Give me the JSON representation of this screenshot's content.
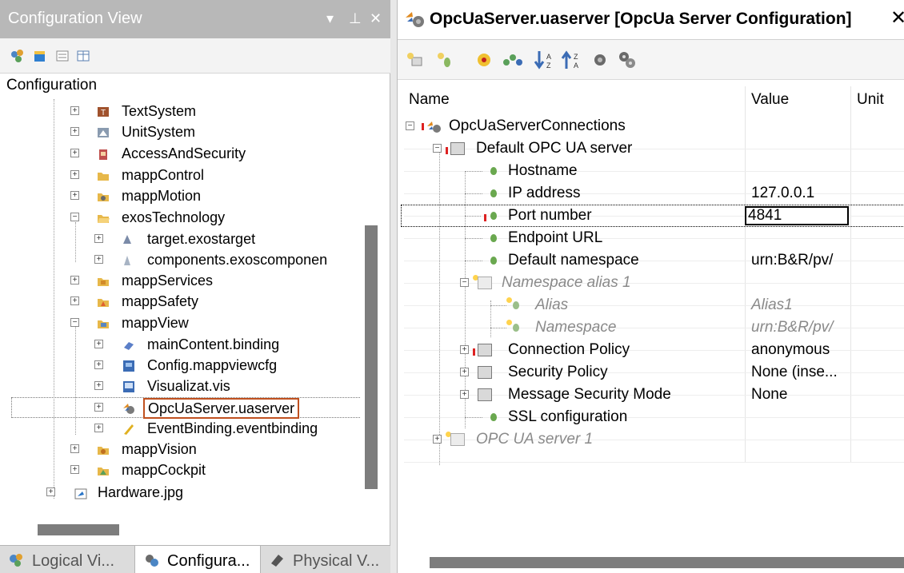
{
  "colors": {
    "title_bar_bg": "#b8b8b8",
    "selection_border": "#c0501f",
    "leaf_green": "#6aa84f",
    "error_red": "#dd2222",
    "folder_yellow": "#e7b84a"
  },
  "left_panel": {
    "title": "Configuration View",
    "controls": {
      "dropdown": "▾",
      "pin": "⊥",
      "close": "✕"
    },
    "toolbar_icons": [
      "logical-icon",
      "cube-icon",
      "list-icon",
      "table-icon"
    ],
    "tree": {
      "root": "Configuration",
      "items": [
        {
          "label": "TextSystem",
          "icon": "text-system-icon"
        },
        {
          "label": "UnitSystem",
          "icon": "unit-system-icon"
        },
        {
          "label": "AccessAndSecurity",
          "icon": "security-icon"
        },
        {
          "label": "mappControl",
          "icon": "folder-icon"
        },
        {
          "label": "mappMotion",
          "icon": "folder-icon"
        },
        {
          "label": "exosTechnology",
          "icon": "folder-open-icon"
        },
        {
          "label": "target.exostarget",
          "icon": "target-icon"
        },
        {
          "label": "components.exoscomponen",
          "icon": "components-icon"
        },
        {
          "label": "mappServices",
          "icon": "folder-icon"
        },
        {
          "label": "mappSafety",
          "icon": "folder-icon"
        },
        {
          "label": "mappView",
          "icon": "folder-open-icon"
        },
        {
          "label": "mainContent.binding",
          "icon": "binding-icon"
        },
        {
          "label": "Config.mappviewcfg",
          "icon": "config-icon"
        },
        {
          "label": "Visualizat.vis",
          "icon": "vis-icon"
        },
        {
          "label": "OpcUaServer.uaserver",
          "icon": "uaserver-icon"
        },
        {
          "label": "EventBinding.eventbinding",
          "icon": "eventbinding-icon"
        },
        {
          "label": "mappVision",
          "icon": "folder-icon"
        },
        {
          "label": "mappCockpit",
          "icon": "folder-icon"
        },
        {
          "label": "Hardware.jpg",
          "icon": "hardware-icon"
        }
      ]
    },
    "bottom_tabs": [
      {
        "label": "Logical Vi...",
        "icon": "logical-view-icon"
      },
      {
        "label": "Configura...",
        "icon": "configuration-view-icon"
      },
      {
        "label": "Physical V...",
        "icon": "physical-view-icon"
      }
    ]
  },
  "right_panel": {
    "tab_title": "OpcUaServer.uaserver [OpcUa Server Configuration]",
    "tab_close": "✕",
    "toolbar_icons": [
      "add-node-icon",
      "add-leaf-icon",
      "target-icon",
      "tree-icon",
      "sort-desc-icon",
      "sort-asc-icon",
      "circle-icon",
      "gears-icon"
    ],
    "columns": {
      "name": "Name",
      "value": "Value",
      "unit": "Unit"
    },
    "rows": [
      {
        "name": "OpcUaServerConnections",
        "value": ""
      },
      {
        "name": "Default OPC UA server",
        "value": ""
      },
      {
        "name": "Hostname",
        "value": ""
      },
      {
        "name": "IP address",
        "value": "127.0.0.1"
      },
      {
        "name": "Port number",
        "value": "4841"
      },
      {
        "name": "Endpoint URL",
        "value": ""
      },
      {
        "name": "Default namespace",
        "value": "urn:B&R/pv/"
      },
      {
        "name": "Namespace alias 1",
        "value": ""
      },
      {
        "name": "Alias",
        "value": "Alias1"
      },
      {
        "name": "Namespace",
        "value": "urn:B&R/pv/"
      },
      {
        "name": "Connection Policy",
        "value": "anonymous"
      },
      {
        "name": "Security Policy",
        "value": "None (inse..."
      },
      {
        "name": "Message Security Mode",
        "value": "None"
      },
      {
        "name": "SSL configuration",
        "value": ""
      },
      {
        "name": "OPC UA server 1",
        "value": ""
      }
    ]
  }
}
